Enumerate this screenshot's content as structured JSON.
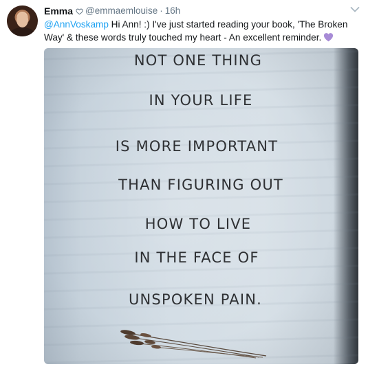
{
  "tweet": {
    "author_name": "Emma",
    "author_handle": "@emmaemlouise",
    "separator": "·",
    "timestamp": "16h",
    "mention": "@AnnVoskamp",
    "body_text": " Hi Ann! :) I've just started reading your book, 'The Broken Way' & these words truly touched my heart - An excellent reminder.",
    "emoji": "purple-heart",
    "icons": {
      "author_badge": "heart-outline-icon",
      "menu": "chevron-down-icon"
    }
  },
  "photo": {
    "quote_lines": [
      "NOT ONE THING",
      "IN YOUR LIFE",
      "IS MORE IMPORTANT",
      "THAN FIGURING OUT",
      "HOW TO LIVE",
      "IN THE FACE OF",
      "UNSPOKEN PAIN."
    ],
    "ornament": "wheat-stalks"
  },
  "colors": {
    "link": "#1da1f2",
    "secondary_text": "#657786",
    "emoji_purple": "#a78bd6"
  }
}
